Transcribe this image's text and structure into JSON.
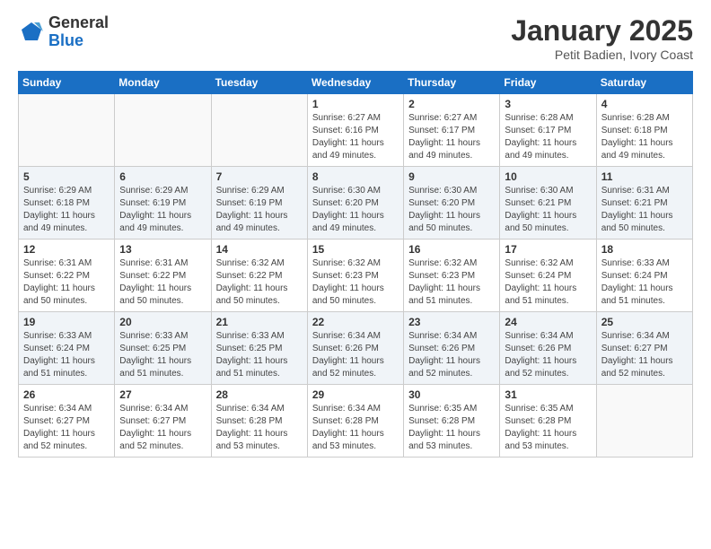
{
  "header": {
    "logo_general": "General",
    "logo_blue": "Blue",
    "title": "January 2025",
    "subtitle": "Petit Badien, Ivory Coast"
  },
  "calendar": {
    "days_of_week": [
      "Sunday",
      "Monday",
      "Tuesday",
      "Wednesday",
      "Thursday",
      "Friday",
      "Saturday"
    ],
    "weeks": [
      [
        {
          "day": "",
          "info": ""
        },
        {
          "day": "",
          "info": ""
        },
        {
          "day": "",
          "info": ""
        },
        {
          "day": "1",
          "info": "Sunrise: 6:27 AM\nSunset: 6:16 PM\nDaylight: 11 hours\nand 49 minutes."
        },
        {
          "day": "2",
          "info": "Sunrise: 6:27 AM\nSunset: 6:17 PM\nDaylight: 11 hours\nand 49 minutes."
        },
        {
          "day": "3",
          "info": "Sunrise: 6:28 AM\nSunset: 6:17 PM\nDaylight: 11 hours\nand 49 minutes."
        },
        {
          "day": "4",
          "info": "Sunrise: 6:28 AM\nSunset: 6:18 PM\nDaylight: 11 hours\nand 49 minutes."
        }
      ],
      [
        {
          "day": "5",
          "info": "Sunrise: 6:29 AM\nSunset: 6:18 PM\nDaylight: 11 hours\nand 49 minutes."
        },
        {
          "day": "6",
          "info": "Sunrise: 6:29 AM\nSunset: 6:19 PM\nDaylight: 11 hours\nand 49 minutes."
        },
        {
          "day": "7",
          "info": "Sunrise: 6:29 AM\nSunset: 6:19 PM\nDaylight: 11 hours\nand 49 minutes."
        },
        {
          "day": "8",
          "info": "Sunrise: 6:30 AM\nSunset: 6:20 PM\nDaylight: 11 hours\nand 49 minutes."
        },
        {
          "day": "9",
          "info": "Sunrise: 6:30 AM\nSunset: 6:20 PM\nDaylight: 11 hours\nand 50 minutes."
        },
        {
          "day": "10",
          "info": "Sunrise: 6:30 AM\nSunset: 6:21 PM\nDaylight: 11 hours\nand 50 minutes."
        },
        {
          "day": "11",
          "info": "Sunrise: 6:31 AM\nSunset: 6:21 PM\nDaylight: 11 hours\nand 50 minutes."
        }
      ],
      [
        {
          "day": "12",
          "info": "Sunrise: 6:31 AM\nSunset: 6:22 PM\nDaylight: 11 hours\nand 50 minutes."
        },
        {
          "day": "13",
          "info": "Sunrise: 6:31 AM\nSunset: 6:22 PM\nDaylight: 11 hours\nand 50 minutes."
        },
        {
          "day": "14",
          "info": "Sunrise: 6:32 AM\nSunset: 6:22 PM\nDaylight: 11 hours\nand 50 minutes."
        },
        {
          "day": "15",
          "info": "Sunrise: 6:32 AM\nSunset: 6:23 PM\nDaylight: 11 hours\nand 50 minutes."
        },
        {
          "day": "16",
          "info": "Sunrise: 6:32 AM\nSunset: 6:23 PM\nDaylight: 11 hours\nand 51 minutes."
        },
        {
          "day": "17",
          "info": "Sunrise: 6:32 AM\nSunset: 6:24 PM\nDaylight: 11 hours\nand 51 minutes."
        },
        {
          "day": "18",
          "info": "Sunrise: 6:33 AM\nSunset: 6:24 PM\nDaylight: 11 hours\nand 51 minutes."
        }
      ],
      [
        {
          "day": "19",
          "info": "Sunrise: 6:33 AM\nSunset: 6:24 PM\nDaylight: 11 hours\nand 51 minutes."
        },
        {
          "day": "20",
          "info": "Sunrise: 6:33 AM\nSunset: 6:25 PM\nDaylight: 11 hours\nand 51 minutes."
        },
        {
          "day": "21",
          "info": "Sunrise: 6:33 AM\nSunset: 6:25 PM\nDaylight: 11 hours\nand 51 minutes."
        },
        {
          "day": "22",
          "info": "Sunrise: 6:34 AM\nSunset: 6:26 PM\nDaylight: 11 hours\nand 52 minutes."
        },
        {
          "day": "23",
          "info": "Sunrise: 6:34 AM\nSunset: 6:26 PM\nDaylight: 11 hours\nand 52 minutes."
        },
        {
          "day": "24",
          "info": "Sunrise: 6:34 AM\nSunset: 6:26 PM\nDaylight: 11 hours\nand 52 minutes."
        },
        {
          "day": "25",
          "info": "Sunrise: 6:34 AM\nSunset: 6:27 PM\nDaylight: 11 hours\nand 52 minutes."
        }
      ],
      [
        {
          "day": "26",
          "info": "Sunrise: 6:34 AM\nSunset: 6:27 PM\nDaylight: 11 hours\nand 52 minutes."
        },
        {
          "day": "27",
          "info": "Sunrise: 6:34 AM\nSunset: 6:27 PM\nDaylight: 11 hours\nand 52 minutes."
        },
        {
          "day": "28",
          "info": "Sunrise: 6:34 AM\nSunset: 6:28 PM\nDaylight: 11 hours\nand 53 minutes."
        },
        {
          "day": "29",
          "info": "Sunrise: 6:34 AM\nSunset: 6:28 PM\nDaylight: 11 hours\nand 53 minutes."
        },
        {
          "day": "30",
          "info": "Sunrise: 6:35 AM\nSunset: 6:28 PM\nDaylight: 11 hours\nand 53 minutes."
        },
        {
          "day": "31",
          "info": "Sunrise: 6:35 AM\nSunset: 6:28 PM\nDaylight: 11 hours\nand 53 minutes."
        },
        {
          "day": "",
          "info": ""
        }
      ]
    ]
  }
}
